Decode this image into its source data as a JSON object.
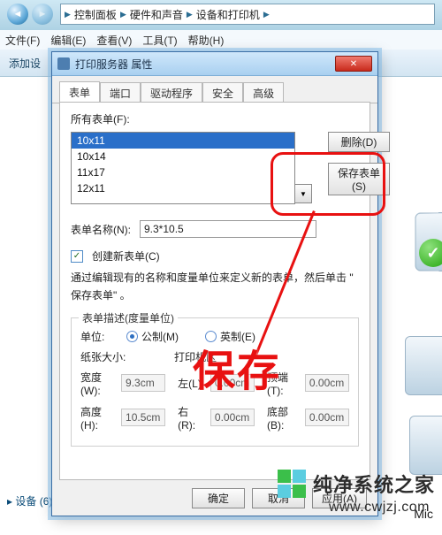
{
  "breadcrumb": {
    "seg1": "控制面板",
    "seg2": "硬件和声音",
    "seg3": "设备和打印机"
  },
  "menubar": {
    "file": "文件(F)",
    "edit": "编辑(E)",
    "view": "查看(V)",
    "tools": "工具(T)",
    "help": "帮助(H)"
  },
  "cmdbar": {
    "add_device": "添加设"
  },
  "dialog": {
    "title": "打印服务器 属性",
    "tabs": {
      "forms": "表单",
      "ports": "端口",
      "drivers": "驱动程序",
      "security": "安全",
      "advanced": "高级"
    },
    "forms_label": "所有表单(F):",
    "form_items": [
      "10x11",
      "10x14",
      "11x17",
      "12x11"
    ],
    "delete_btn": "删除(D)",
    "save_form_btn": "保存表单(S)",
    "form_name_label": "表单名称(N):",
    "form_name_value": "9.3*10.5",
    "create_new_label": "创建新表单(C)",
    "hint_line": "通过编辑现有的名称和度量单位来定义新的表单，然后单击 \" 保存表单\" 。",
    "group_title": "表单描述(度量单位)",
    "unit_label": "单位:",
    "metric_label": "公制(M)",
    "english_label": "英制(E)",
    "paper_size_label": "纸张大小:",
    "printer_area_label": "打印机区",
    "width_label": "宽度(W):",
    "width_value": "9.3cm",
    "height_label": "高度(H):",
    "height_value": "10.5cm",
    "left_label": "左(L):",
    "left_value": "0.00cm",
    "right_label": "右(R):",
    "right_value": "0.00cm",
    "top_label": "顶端(T):",
    "top_value": "0.00cm",
    "bottom_label": "底部(B):",
    "bottom_value": "0.00cm",
    "ok_btn": "确定",
    "cancel_btn": "取消",
    "apply_btn": "应用(A)"
  },
  "devices_footer": "▸ 设备 (6)",
  "bottom_right_label": "Mic",
  "watermark": {
    "text": "纯净系统之家",
    "url": "www.cwjzj.com"
  },
  "highlight": {
    "text": "保存"
  },
  "colors": {
    "accent_red": "#e81111",
    "aero_blue": "#2a6fc9"
  }
}
